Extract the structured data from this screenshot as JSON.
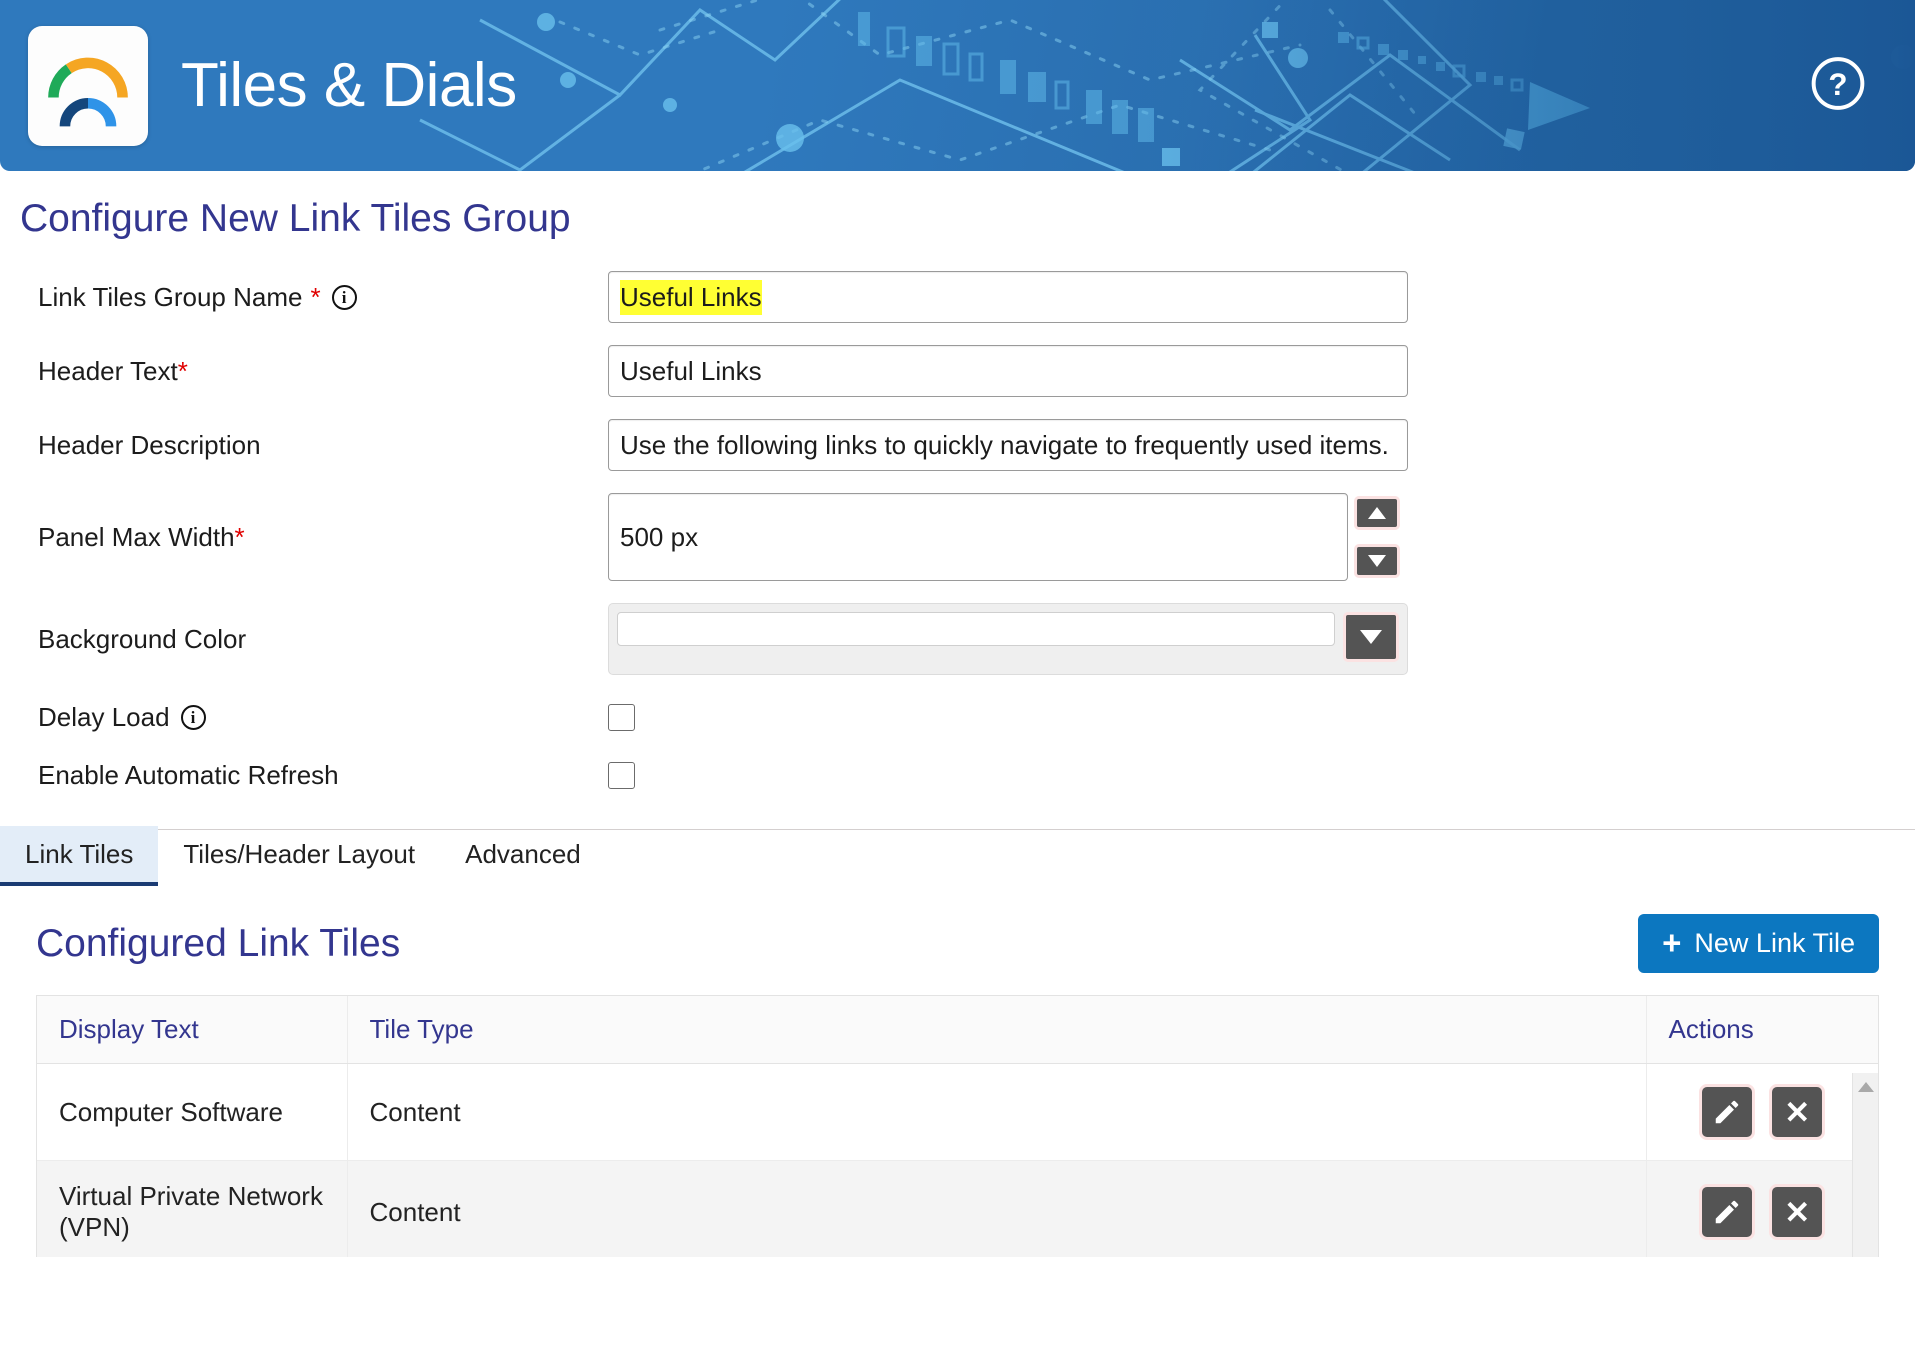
{
  "header": {
    "app_title": "Tiles & Dials",
    "logo_icon": "gauge-dial-logo",
    "help_icon": "help-circle-icon",
    "colors": {
      "banner_left": "#2f79bd",
      "banner_right": "#1b5796",
      "art_line": "#6fc4ef"
    }
  },
  "page": {
    "title": "Configure New Link Tiles Group",
    "title_color": "#33368f"
  },
  "form": {
    "fields": [
      {
        "label": "Link Tiles Group Name",
        "required_mark": "*",
        "info_icon": "info-circle-icon",
        "value": "Useful Links",
        "selected_text": "Useful Links"
      },
      {
        "label": "Header Text",
        "required_mark": "*",
        "value": "Useful Links"
      },
      {
        "label": "Header Description",
        "value": "Use the following links to quickly navigate to frequently used items."
      },
      {
        "label": "Panel Max Width",
        "required_mark": "*",
        "value": "500 px",
        "spinner_up_icon": "triangle-up-icon",
        "spinner_down_icon": "triangle-down-icon"
      },
      {
        "label": "Background Color",
        "value": "",
        "dropdown_icon": "triangle-down-icon"
      }
    ],
    "checkboxes": [
      {
        "label": "Delay Load",
        "info_icon": "info-circle-icon",
        "checked": false
      },
      {
        "label": "Enable Automatic Refresh",
        "checked": false
      }
    ]
  },
  "tabs": {
    "items": [
      {
        "label": "Link Tiles",
        "active": true
      },
      {
        "label": "Tiles/Header Layout",
        "active": false
      },
      {
        "label": "Advanced",
        "active": false
      }
    ],
    "active_color": "#1b3b73",
    "active_bg": "#e3edf8"
  },
  "tiles_section": {
    "title": "Configured Link Tiles",
    "new_button": {
      "label": "New Link Tile",
      "plus_icon": "plus-icon",
      "color": "#0c77c0"
    },
    "table": {
      "columns": [
        "Display Text",
        "Tile Type",
        "Actions"
      ],
      "rows": [
        {
          "display_text": "Computer Software",
          "tile_type": "Content",
          "edit_icon": "pencil-icon",
          "delete_icon": "close-x-icon"
        },
        {
          "display_text": "Virtual Private Network (VPN)",
          "tile_type": "Content",
          "edit_icon": "pencil-icon",
          "delete_icon": "close-x-icon"
        }
      ],
      "scrollbar_up_icon": "scroll-up-arrow-icon"
    }
  }
}
